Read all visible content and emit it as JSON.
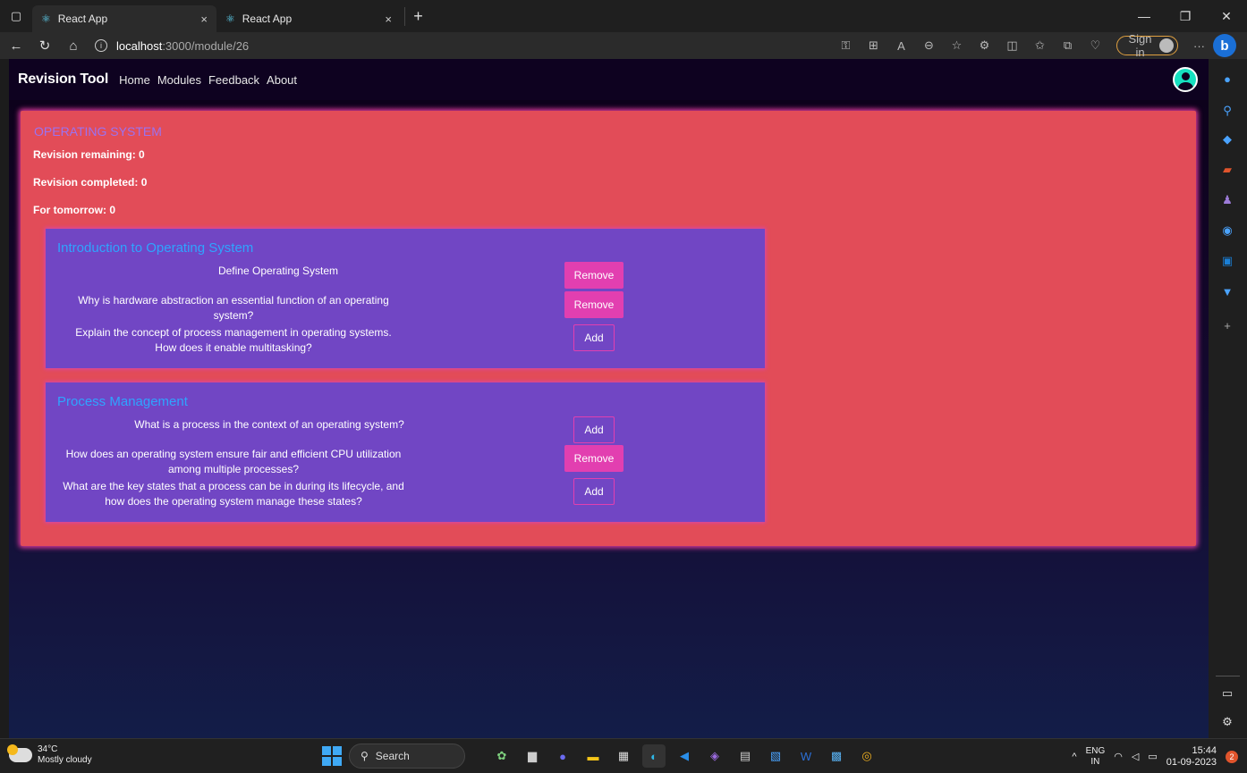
{
  "browser": {
    "tabs": [
      {
        "title": "React App",
        "close": "×"
      },
      {
        "title": "React App",
        "close": "×"
      }
    ],
    "new_tab": "+",
    "window_controls": {
      "minimize": "—",
      "restore": "❐",
      "close": "✕"
    },
    "url": {
      "host": "localhost",
      "path": ":3000/module/26"
    },
    "sign_in_label": "Sign in",
    "more": "···",
    "copilot_label": "b"
  },
  "app": {
    "brand": "Revision Tool",
    "nav": [
      "Home",
      "Modules",
      "Feedback",
      "About"
    ]
  },
  "module": {
    "title": "OPERATING SYSTEM",
    "stats": {
      "remaining": "Revision remaining: 0",
      "completed": "Revision completed: 0",
      "tomorrow": "For tomorrow: 0"
    },
    "topics": [
      {
        "title": "Introduction to Operating System",
        "questions": [
          {
            "text": "Define Operating System",
            "action": "Remove"
          },
          {
            "text": "Why is hardware abstraction an essential function of an operating system?",
            "action": "Remove"
          },
          {
            "text": "Explain the concept of process management in operating systems. How does it enable multitasking?",
            "action": "Add"
          }
        ]
      },
      {
        "title": "Process Management",
        "questions": [
          {
            "text": "What is a process in the context of an operating system?",
            "action": "Add"
          },
          {
            "text": "How does an operating system ensure fair and efficient CPU utilization among multiple processes?",
            "action": "Remove"
          },
          {
            "text": "What are the key states that a process can be in during its lifecycle, and how does the operating system manage these states?",
            "action": "Add"
          }
        ]
      }
    ]
  },
  "taskbar": {
    "weather": {
      "temp": "34°C",
      "condition": "Mostly cloudy"
    },
    "search_label": "Search",
    "lang": {
      "line1": "ENG",
      "line2": "IN"
    },
    "time": "15:44",
    "date": "01-09-2023",
    "notifications": "2"
  },
  "colors": {
    "module_bg": "#e24c58",
    "topic_bg": "#7146c4",
    "topic_title": "#2fa4ff",
    "module_title": "#9b72f0",
    "button_accent": "#e23fb0"
  }
}
